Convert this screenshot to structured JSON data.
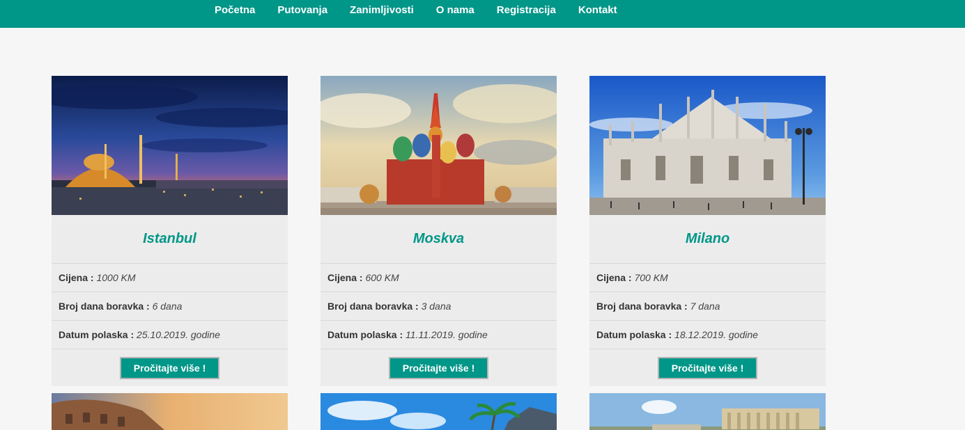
{
  "nav": {
    "items": [
      "Početna",
      "Putovanja",
      "Zanimljivosti",
      "O nama",
      "Registracija",
      "Kontakt"
    ]
  },
  "labels": {
    "price": "Cijena :",
    "days": "Broj dana boravka :",
    "departure": "Datum polaska :",
    "read_more": "Pročitajte više !"
  },
  "cards": [
    {
      "city": "Istanbul",
      "price": "1000 KM",
      "days": "6 dana",
      "departure": "25.10.2019. godine",
      "image": "istanbul-mosque-night"
    },
    {
      "city": "Moskva",
      "price": "600 KM",
      "days": "3 dana",
      "departure": "11.11.2019. godine",
      "image": "st-basils-cathedral"
    },
    {
      "city": "Milano",
      "price": "700 KM",
      "days": "7 dana",
      "departure": "18.12.2019. godine",
      "image": "milan-cathedral"
    }
  ],
  "bottom_images": [
    "colosseum",
    "tropical-beach",
    "acropolis"
  ],
  "colors": {
    "accent": "#009688",
    "card_bg": "#ececec",
    "page_bg": "#f6f6f6"
  }
}
